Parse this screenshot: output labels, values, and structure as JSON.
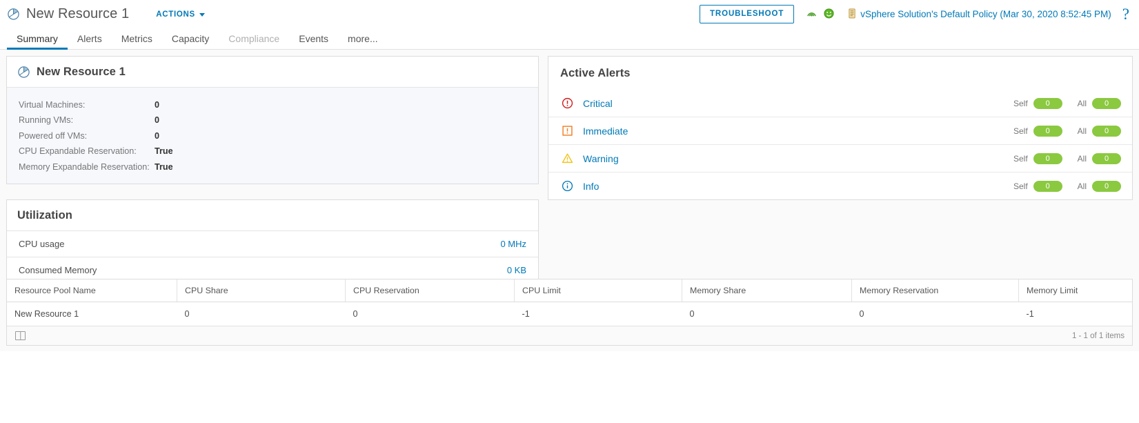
{
  "header": {
    "object_icon": "resource-pool-icon",
    "title": "New Resource 1",
    "actions_label": "ACTIONS",
    "troubleshoot_label": "TROUBLESHOOT",
    "status_icon_1": "collecting-data-icon",
    "status_icon_2": "health-green-icon",
    "policy_icon": "policy-icon",
    "policy_text": "vSphere Solution's Default Policy (Mar 30, 2020 8:52:45 PM)",
    "help_label": "?",
    "accent_color": "#0079b8"
  },
  "tabs": [
    {
      "label": "Summary",
      "state": "active"
    },
    {
      "label": "Alerts",
      "state": "normal"
    },
    {
      "label": "Metrics",
      "state": "normal"
    },
    {
      "label": "Capacity",
      "state": "normal"
    },
    {
      "label": "Compliance",
      "state": "disabled"
    },
    {
      "label": "Events",
      "state": "normal"
    },
    {
      "label": "more...",
      "state": "normal"
    }
  ],
  "summary_card": {
    "icon": "resource-pool-icon",
    "title": "New Resource 1",
    "properties": [
      {
        "label": "Virtual Machines:",
        "value": "0"
      },
      {
        "label": "Running VMs:",
        "value": "0"
      },
      {
        "label": "Powered off VMs:",
        "value": "0"
      },
      {
        "label": "CPU Expandable Reservation:",
        "value": "True"
      },
      {
        "label": "Memory Expandable Reservation:",
        "value": "True"
      }
    ]
  },
  "utilization": {
    "title": "Utilization",
    "rows": [
      {
        "label": "CPU usage",
        "value": "0 MHz"
      },
      {
        "label": "Consumed Memory",
        "value": "0 KB"
      }
    ]
  },
  "active_alerts": {
    "title": "Active Alerts",
    "self_label": "Self",
    "all_label": "All",
    "badge_color": "#8bc940",
    "rows": [
      {
        "icon": "critical-icon",
        "icon_color": "#d01f1f",
        "name": "Critical",
        "self": "0",
        "all": "0"
      },
      {
        "icon": "immediate-icon",
        "icon_color": "#f27c20",
        "name": "Immediate",
        "self": "0",
        "all": "0"
      },
      {
        "icon": "warning-icon",
        "icon_color": "#f2c41e",
        "name": "Warning",
        "self": "0",
        "all": "0"
      },
      {
        "icon": "info-icon",
        "icon_color": "#0079b8",
        "name": "Info",
        "self": "0",
        "all": "0"
      }
    ]
  },
  "table": {
    "columns": [
      "Resource Pool Name",
      "CPU Share",
      "CPU Reservation",
      "CPU Limit",
      "Memory Share",
      "Memory Reservation",
      "Memory Limit"
    ],
    "rows": [
      {
        "name": "New Resource 1",
        "cpu_share": "0",
        "cpu_reservation": "0",
        "cpu_limit": "-1",
        "memory_share": "0",
        "memory_reservation": "0",
        "memory_limit": "-1"
      }
    ],
    "footer_icon": "column-chooser-icon",
    "footer_count": "1 - 1 of 1 items"
  }
}
